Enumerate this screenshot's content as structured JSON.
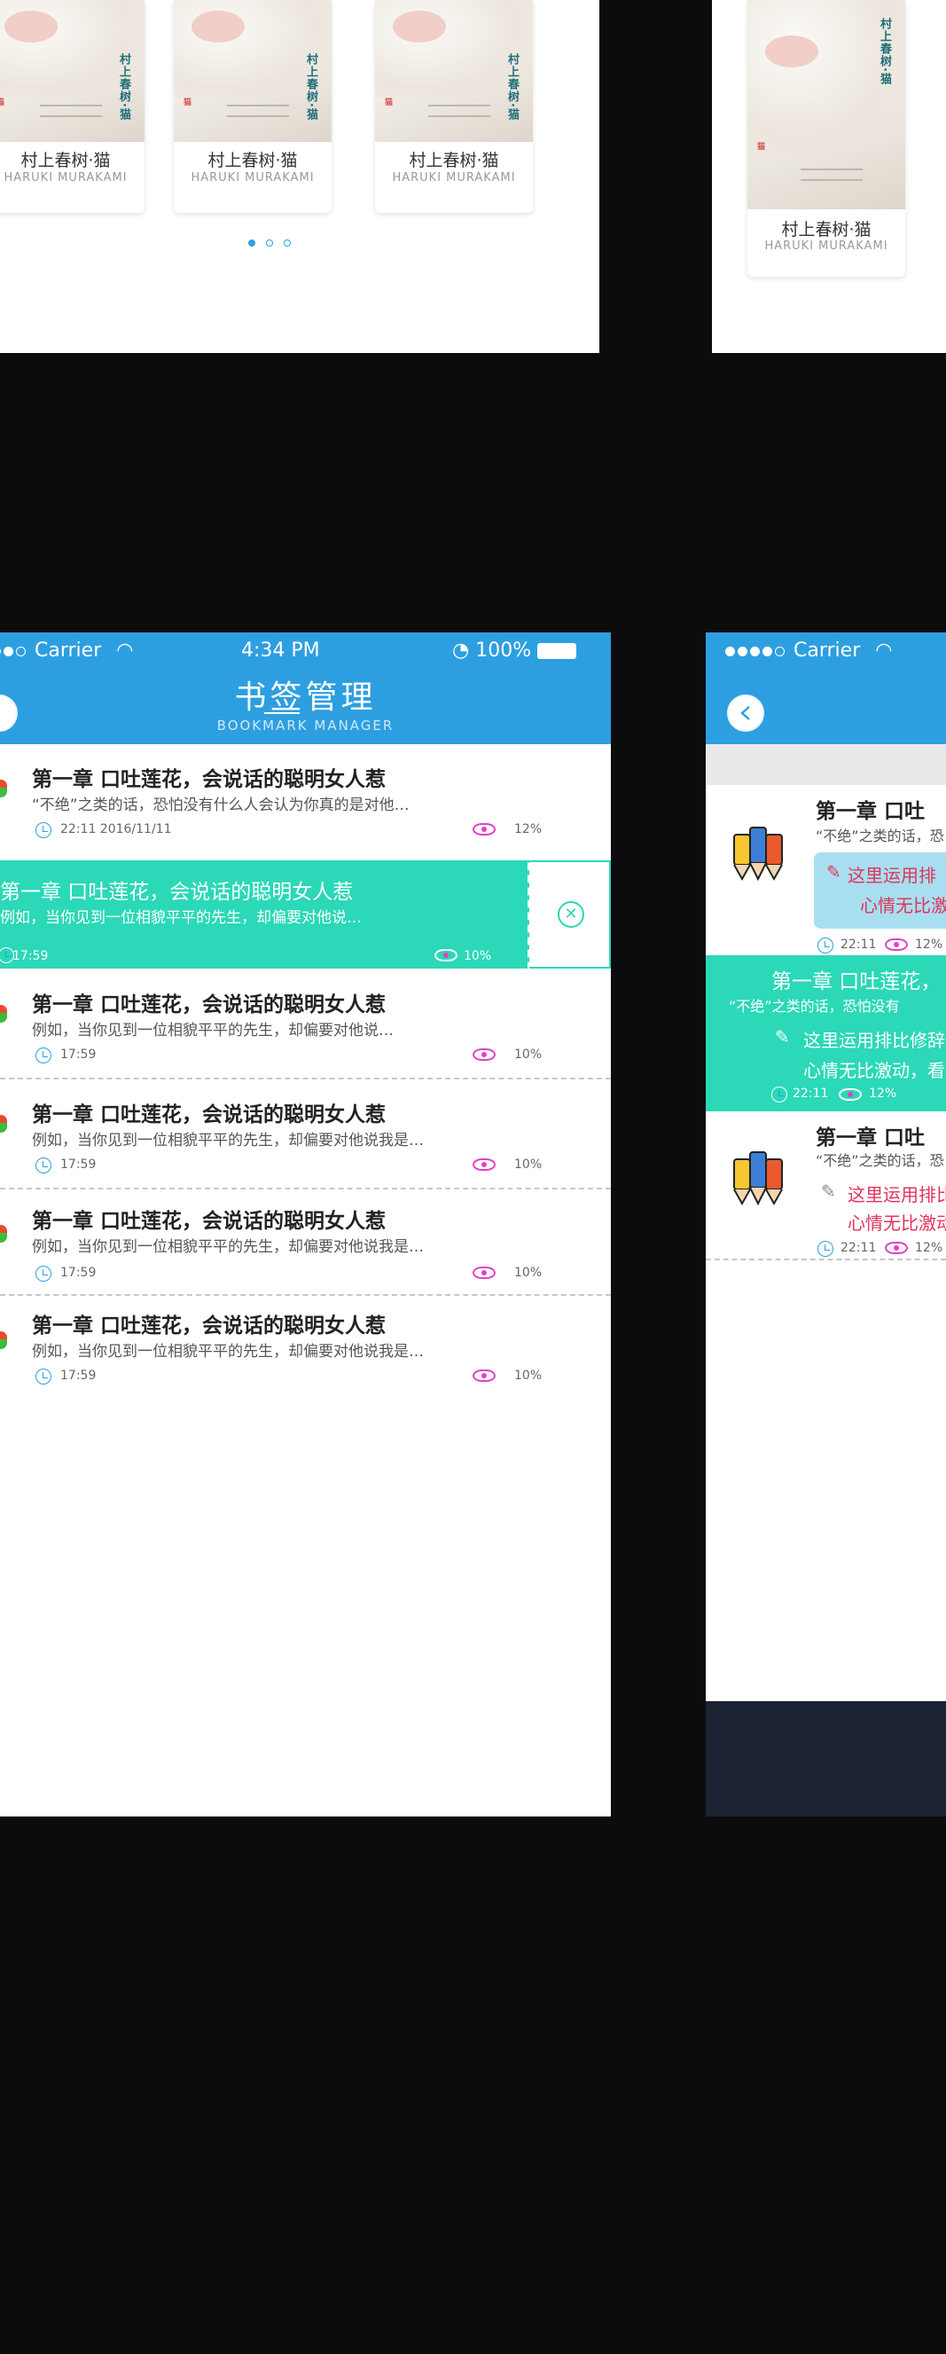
{
  "book_cards": {
    "items": [
      {
        "title": "村上春树·猫",
        "author": "HARUKI MURAKAMI",
        "cover_vertical": "村上春树·猫",
        "cover_side": "猫"
      },
      {
        "title": "村上春树·猫",
        "author": "HARUKI MURAKAMI",
        "cover_vertical": "村上春树·猫",
        "cover_side": "猫"
      },
      {
        "title": "村上春树·猫",
        "author": "HARUKI MURAKAMI",
        "cover_vertical": "村上春树·猫",
        "cover_side": "猫"
      }
    ],
    "pager": {
      "count": 3,
      "active": 0
    },
    "right_card": {
      "title": "村上春树·猫",
      "author": "HARUKI MURAKAMI",
      "cover_vertical": "村上春树·猫",
      "cover_side": "猫"
    }
  },
  "bookmark_screen": {
    "status": {
      "carrier": "Carrier",
      "time": "4:34 PM",
      "battery": "100%"
    },
    "nav": {
      "title": "书签管理",
      "subtitle": "BOOKMARK MANAGER"
    },
    "rows": [
      {
        "title": "第一章   口吐莲花，会说话的聪明女人惹",
        "desc": "“不绝”之类的话，恐怕没有什么人会认为你真的是对他…",
        "time": "22:11    2016/11/11",
        "pct": "12%"
      },
      {
        "title": "第一章   口吐莲花，会说话的聪明女人惹",
        "desc": "例如，当你见到一位相貌平平的先生，却偏要对他说…",
        "time": "17:59",
        "pct": "10%"
      },
      {
        "title": "第一章   口吐莲花，会说话的聪明女人惹",
        "desc": "例如，当你见到一位相貌平平的先生，却偏要对他说我是…",
        "time": "17:59",
        "pct": "10%"
      },
      {
        "title": "第一章   口吐莲花，会说话的聪明女人惹",
        "desc": "例如，当你见到一位相貌平平的先生，却偏要对他说我是…",
        "time": "17:59",
        "pct": "10%"
      },
      {
        "title": "第一章   口吐莲花，会说话的聪明女人惹",
        "desc": "例如，当你见到一位相貌平平的先生，却偏要对他说我是…",
        "time": "17:59",
        "pct": "10%"
      }
    ],
    "swiped_row": {
      "title": "第一章   口吐莲花，会说话的聪明女人惹",
      "desc": "例如，当你见到一位相貌平平的先生，却偏要对他说…",
      "time": "17:59",
      "pct": "10%"
    }
  },
  "notes_screen": {
    "status": {
      "carrier": "Carrier"
    },
    "rows": [
      {
        "title": "第一章   口吐",
        "desc": "“不绝”之类的话，恐",
        "note_line1": "这里运用排",
        "note_line2": "心情无比激",
        "time": "22:11",
        "pct": "12%"
      },
      {
        "title": "第一章   口吐莲花，",
        "desc": "“不绝”之类的话，恐怕没有",
        "note_line1": "这里运用排比修辞",
        "note_line2": "心情无比激动，看",
        "time": "22:11",
        "pct": "12%"
      },
      {
        "title": "第一章   口吐",
        "desc": "“不绝”之类的话，恐",
        "note_line1": "这里运用排比",
        "note_line2": "心情无比激动",
        "time": "22:11",
        "pct": "12%"
      }
    ]
  },
  "colors": {
    "primary_blue": "#2d9fe0",
    "teal": "#2bd8b7",
    "eye_pink": "#e33fc7",
    "note_red": "#e2335a",
    "bg": "#0c0c0e",
    "footer": "#1c2332"
  }
}
